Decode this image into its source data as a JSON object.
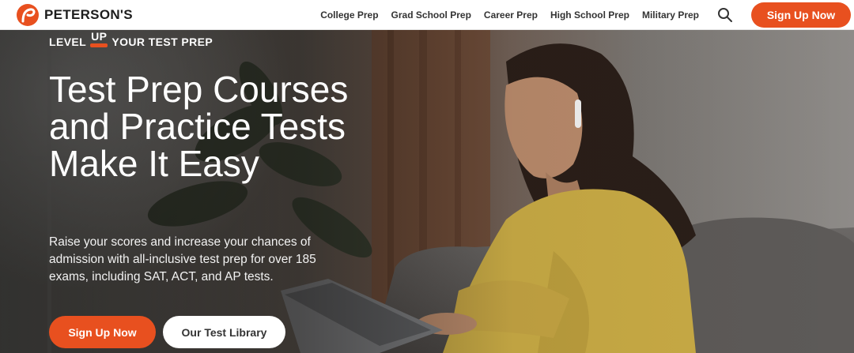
{
  "brand": {
    "name": "PETERSON'S",
    "logo_icon": "petersons-logo-icon",
    "accent_color": "#e8501f"
  },
  "nav": {
    "links": [
      {
        "label": "College Prep"
      },
      {
        "label": "Grad School Prep"
      },
      {
        "label": "Career Prep"
      },
      {
        "label": "High School Prep"
      },
      {
        "label": "Military Prep"
      }
    ],
    "search_icon": "search-icon",
    "signup_label": "Sign Up Now"
  },
  "hero": {
    "eyebrow_before": "LEVEL",
    "eyebrow_up": "UP",
    "eyebrow_after": "YOUR TEST PREP",
    "title": "Test Prep Courses and Practice Tests Make It Easy",
    "description": "Raise your scores and increase your chances of admission with all-inclusive test prep for over 185 exams, including SAT, ACT, and AP tests.",
    "primary_cta": "Sign Up Now",
    "secondary_cta": "Our Test Library",
    "image_description_icon": "student-with-laptop-photo"
  }
}
